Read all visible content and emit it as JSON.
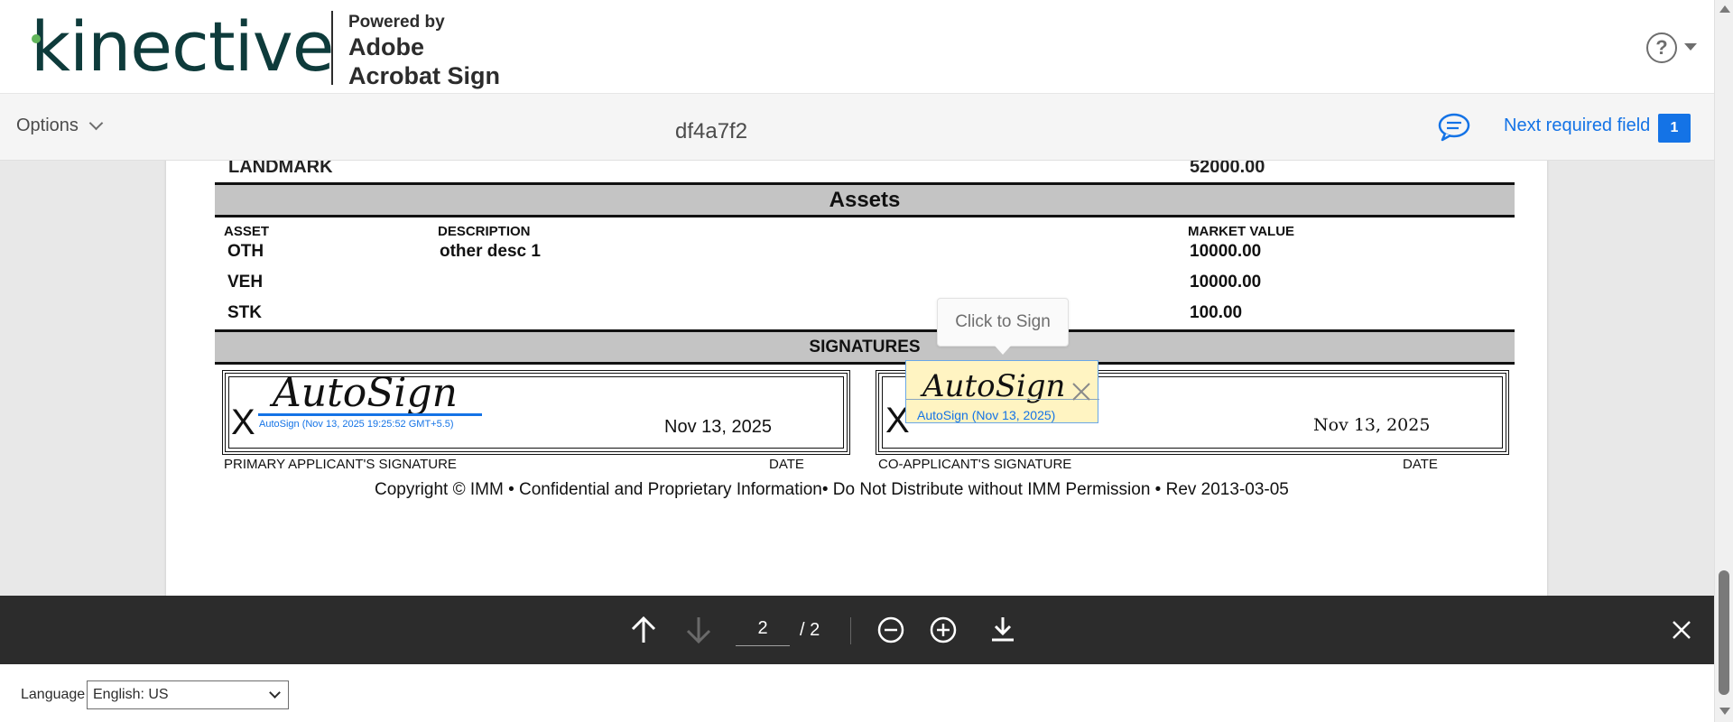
{
  "header": {
    "logo_text": "kinective",
    "powered_line1": "Powered by",
    "powered_line2": "Adobe",
    "powered_line3": "Acrobat Sign",
    "help_symbol": "?"
  },
  "toolbar": {
    "options_label": "Options",
    "document_title": "df4a7f2",
    "next_required_label": "Next required field",
    "next_required_count": "1",
    "comment_icon": "speech-bubble-icon"
  },
  "document": {
    "landmark_label": "LANDMARK",
    "landmark_value": "52000.00",
    "assets_heading": "Assets",
    "columns": [
      "ASSET",
      "DESCRIPTION",
      "MARKET VALUE"
    ],
    "rows": [
      {
        "asset": "OTH",
        "description": "other desc 1",
        "value": "10000.00"
      },
      {
        "asset": "VEH",
        "description": "",
        "value": "10000.00"
      },
      {
        "asset": "STK",
        "description": "",
        "value": "100.00"
      }
    ],
    "signatures_heading": "SIGNATURES",
    "primary": {
      "x_mark": "X",
      "signature": "AutoSign",
      "meta": "AutoSign (Nov 13, 2025 19:25:52 GMT+5.5)",
      "date": "Nov 13, 2025",
      "label": "PRIMARY APPLICANT'S SIGNATURE",
      "date_label": "DATE"
    },
    "co": {
      "x_mark": "X",
      "signature": "AutoSign",
      "meta": "AutoSign (Nov 13, 2025)",
      "date": "Nov 13, 2025",
      "label": "CO-APPLICANT'S SIGNATURE",
      "date_label": "DATE"
    },
    "tooltip": "Click to Sign",
    "copyright": "Copyright © IMM • Confidential and Proprietary Information• Do Not Distribute without IMM Permission • Rev 2013-03-05"
  },
  "navigation": {
    "current_page": "2",
    "total_pages": "/ 2"
  },
  "footer": {
    "language_label": "Language",
    "language_value": "English: US"
  },
  "colors": {
    "accent": "#1473e6",
    "nav_bar": "#2c2c2c",
    "band_gray": "#c4c4c4",
    "sign_field_bg": "#fff4c2",
    "brand_teal": "#0e3b3b",
    "brand_green": "#62b55b"
  }
}
